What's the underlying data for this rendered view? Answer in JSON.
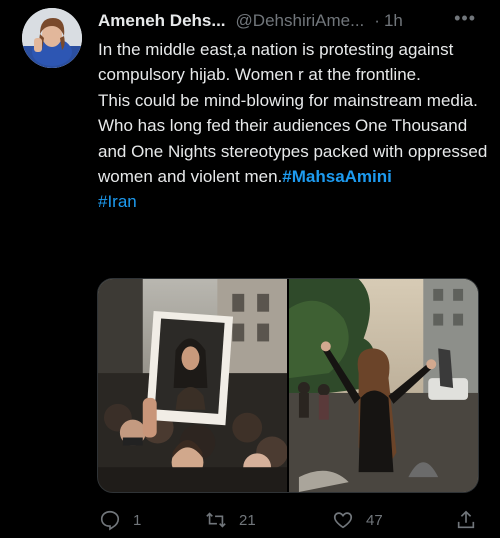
{
  "author": {
    "name": "Ameneh Dehs...",
    "handle": "@DehshiriAme...",
    "separator": "·",
    "time": "1h",
    "more_label": "•••"
  },
  "tweet": {
    "line1": "In the middle east,a nation is protesting against compulsory hijab. Women r at the frontline.",
    "line2_text": "This could be mind-blowing for mainstream media. Who has long fed their audiences One Thousand and One Nights stereotypes packed with oppressed women and violent men.",
    "hashtag1": "#MahsaAmini",
    "hashtag2": "#Iran"
  },
  "media": {
    "image_count": 2
  },
  "actions": {
    "reply_count": "1",
    "retweet_count": "21",
    "like_count": "47"
  },
  "colors": {
    "background": "#000000",
    "text": "#e7e9ea",
    "secondary": "#71767b",
    "link": "#1d9bf0"
  }
}
